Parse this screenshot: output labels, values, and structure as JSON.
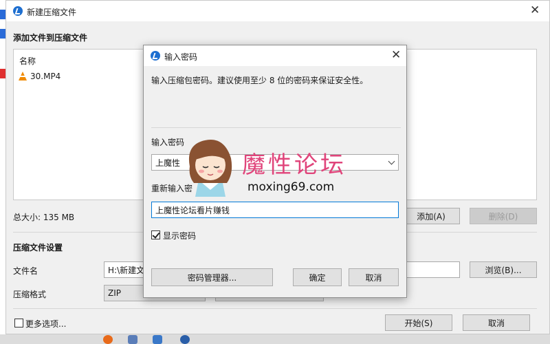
{
  "main_window": {
    "title": "新建压缩文件",
    "add_files_heading": "添加文件到压缩文件",
    "list": {
      "column_header": "名称",
      "files": [
        {
          "name": "30.MP4",
          "icon": "vlc-cone-icon"
        }
      ]
    },
    "total_size": "总大小: 135 MB",
    "add_button": "添加(A)",
    "delete_button": "删除(D)",
    "settings_heading": "压缩文件设置",
    "filename_label": "文件名",
    "filename_value": "H:\\新建文",
    "browse_button": "浏览(B)...",
    "format_label": "压缩格式",
    "format_value": "ZIP",
    "more_options_label": "更多选项...",
    "start_button": "开始(S)",
    "cancel_button": "取消"
  },
  "password_dialog": {
    "title": "输入密码",
    "hint": "输入压缩包密码。建议使用至少 8 位的密码来保证安全性。",
    "password_label": "输入密码",
    "password_value": "上魔性",
    "reenter_label": "重新输入密",
    "reenter_value": "上魔性论坛看片赚钱",
    "show_password_label": "显示密码",
    "show_password_checked": true,
    "manager_button": "密码管理器...",
    "ok_button": "确定",
    "cancel_button": "取消"
  },
  "watermark": {
    "logo_text": "魔性论坛",
    "url": "moxing69.com"
  },
  "colors": {
    "accent": "#1e6fd0",
    "watermark_pink": "#e0457b",
    "focus_border": "#0078d7"
  }
}
